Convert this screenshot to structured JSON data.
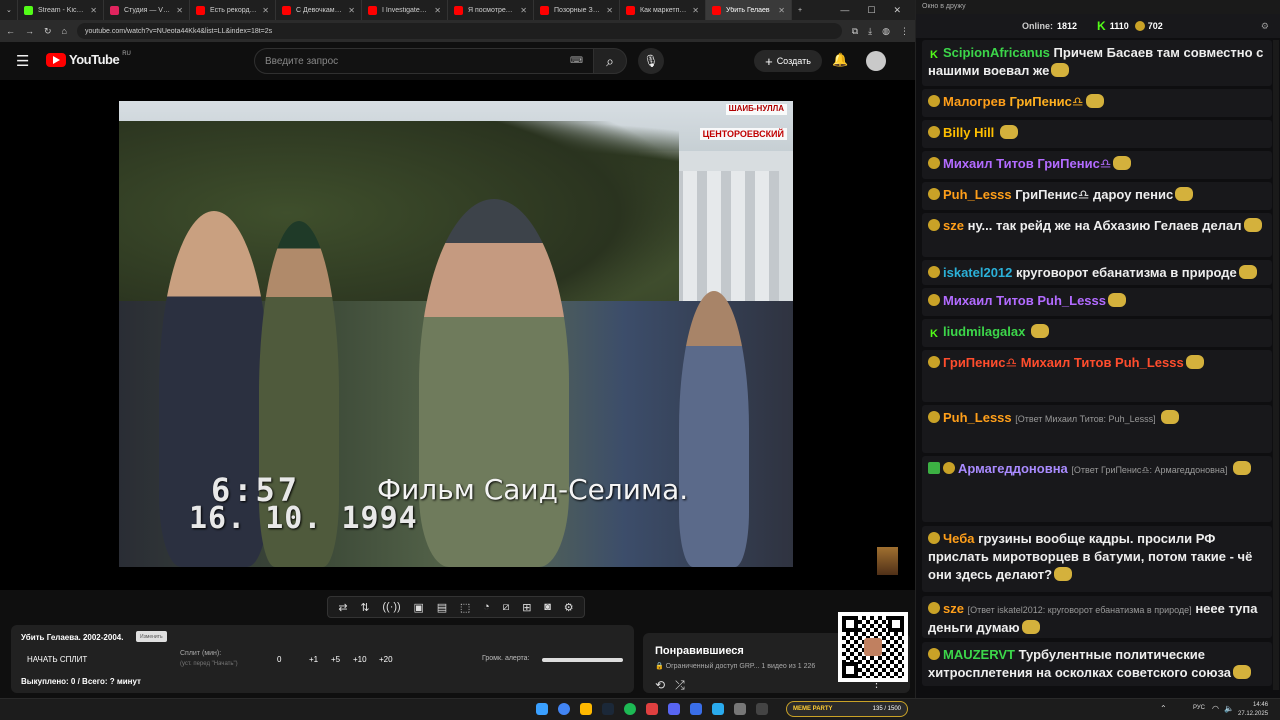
{
  "browser": {
    "tabs": [
      {
        "label": "Stream - Kick Dash",
        "color": "#53fc18"
      },
      {
        "label": "Студия — VK Видео",
        "color": "#e0245e"
      },
      {
        "label": "Есть рекорд! Перв",
        "color": "#ff0000"
      },
      {
        "label": "С Девочками Боли",
        "color": "#ff0000"
      },
      {
        "label": "I Investigated Min",
        "color": "#ff0000"
      },
      {
        "label": "Я посмотрел все с",
        "color": "#ff0000"
      },
      {
        "label": "Позорные Зоозащ",
        "color": "#ff0000"
      },
      {
        "label": "Как маркетплейсы",
        "color": "#ff0000"
      },
      {
        "label": "Убить Гелаев",
        "color": "#ff0000",
        "active": true
      }
    ],
    "url": "youtube.com/watch?v=NUeota44Kk4&list=LL&index=18t=2s"
  },
  "youtube": {
    "logo_text": "YouTube",
    "region": "RU",
    "search_placeholder": "Введите запрос",
    "create_label": "Создать"
  },
  "video": {
    "watermark_top": "ШАИБ-НУЛЛА",
    "watermark_sub": "ЦЕНТОРОЕВСКИЙ",
    "caption": "Фильм Саид-Селима.",
    "time": "6:57",
    "date": "16. 10. 1994"
  },
  "split": {
    "title": "Убить Гелаева. 2002-2004.",
    "small_btn": "Изменить",
    "start": "НАЧАТЬ СПЛИТ",
    "split_label": "Сплит (мин):",
    "split_hint": "(уст. перед \"Начать\")",
    "values": [
      "0",
      "+1",
      "+5",
      "+10",
      "+20"
    ],
    "volume_label": "Громк. алерта:",
    "done": "Выкуплено: 0 / Всего: ? минут"
  },
  "liked": {
    "title": "Понравившиеся",
    "subtitle": "🔒 Ограниченный доступ  GRP...   1 видео из 1 226"
  },
  "chat": {
    "window_title": "Окно в дружу",
    "online_label": "Online:",
    "online_count": "1812",
    "kick_count": "1110",
    "other_count": "702",
    "messages": [
      {
        "user": "ScipionAfricanus",
        "color": "#3cd64a",
        "badge": "kick",
        "text": "Причем Басаев там совместно с нашими воевал же"
      },
      {
        "user": "Малогрев",
        "color": "#ff9f1a",
        "badge": "other",
        "text": "ГриПенис♎",
        "text_color": "#ffb020"
      },
      {
        "user": "Billy Hill",
        "color": "#ffbf00",
        "badge": "other",
        "text": ""
      },
      {
        "user": "Михаил Титов",
        "color": "#b26bff",
        "badge": "other",
        "text": "ГриПенис♎",
        "text_color": "#b26bff"
      },
      {
        "user": "Puh_Lesss",
        "color": "#ff9f1a",
        "badge": "other",
        "text": "ГриПенис♎ дароу пенис"
      },
      {
        "user": "sze",
        "color": "#ff9f1a",
        "badge": "other",
        "text": "ну... так рейд же на Абхазию Гелаев делал"
      },
      {
        "user": "iskatel2012",
        "color": "#2bb0d8",
        "badge": "other",
        "text": "круговорот ебанатизма в природе"
      },
      {
        "user": "Михаил Титов",
        "color": "#b26bff",
        "badge": "other",
        "text": "Puh_Lesss",
        "text_color": "#b26bff"
      },
      {
        "user": "liudmilagalax",
        "color": "#3cd64a",
        "badge": "kick",
        "text": ""
      },
      {
        "user": "ГриПенис♎",
        "color": "#ff4d2d",
        "badge": "other",
        "text": "Михаил Титов Puh_Lesss",
        "text_color": "#ff4d2d"
      },
      {
        "user": "Puh_Lesss",
        "color": "#ff9f1a",
        "badge": "other",
        "reply": "[Ответ Михаил Титов: Puh_Lesss]",
        "text": ""
      },
      {
        "user": "Армагеддоновна",
        "color": "#a98bff",
        "badge": "shield",
        "reply": "[Ответ ГриПенис♎: Армагеддоновна]",
        "text": ""
      },
      {
        "user": "Чеба",
        "color": "#ff9f1a",
        "badge": "other",
        "text": "грузины вообще кадры. просили РФ прислать миротворцев в батуми, потом такие - чё они здесь делают?"
      },
      {
        "user": "sze",
        "color": "#ff9f1a",
        "badge": "other",
        "reply": "[Ответ iskatel2012: круговорот ебанатизма в природе]",
        "text": "неее тупа деньги думаю"
      },
      {
        "user": "MAUZERVT",
        "color": "#3cd64a",
        "badge": "other",
        "text": "Турбулентные политические хитросплетения на осколках советского союза"
      }
    ]
  },
  "taskbar": {
    "memes_label": "MEME PARTY",
    "memes_count": "135 / 1500",
    "lang": "РУС",
    "time": "14:46",
    "date": "27.12.2025"
  }
}
